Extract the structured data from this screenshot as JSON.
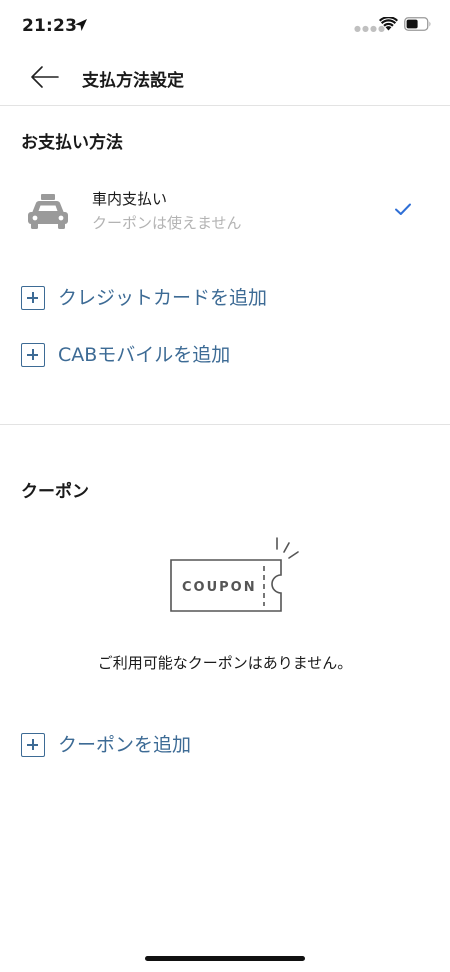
{
  "status_bar": {
    "time": "21:23",
    "icons": [
      "location-arrow-icon",
      "wifi-icon",
      "battery-icon"
    ]
  },
  "nav": {
    "title": "支払方法設定",
    "back_icon": "arrow-left-icon"
  },
  "payment_section": {
    "title": "お支払い方法",
    "method": {
      "icon": "taxi-icon",
      "name": "車内支払い",
      "note": "クーポンは使えません",
      "selected": true
    },
    "add_credit_card_label": "クレジットカードを追加",
    "add_cab_mobile_label": "CABモバイルを追加"
  },
  "coupon_section": {
    "title": "クーポン",
    "illustration_text": "COUPON",
    "empty_message": "ご利用可能なクーポンはありません。",
    "add_coupon_label": "クーポンを追加"
  },
  "colors": {
    "link": "#3d6b95",
    "check": "#2f6fd6",
    "muted_text": "#b3b3b3",
    "divider": "#e3e3e3"
  }
}
